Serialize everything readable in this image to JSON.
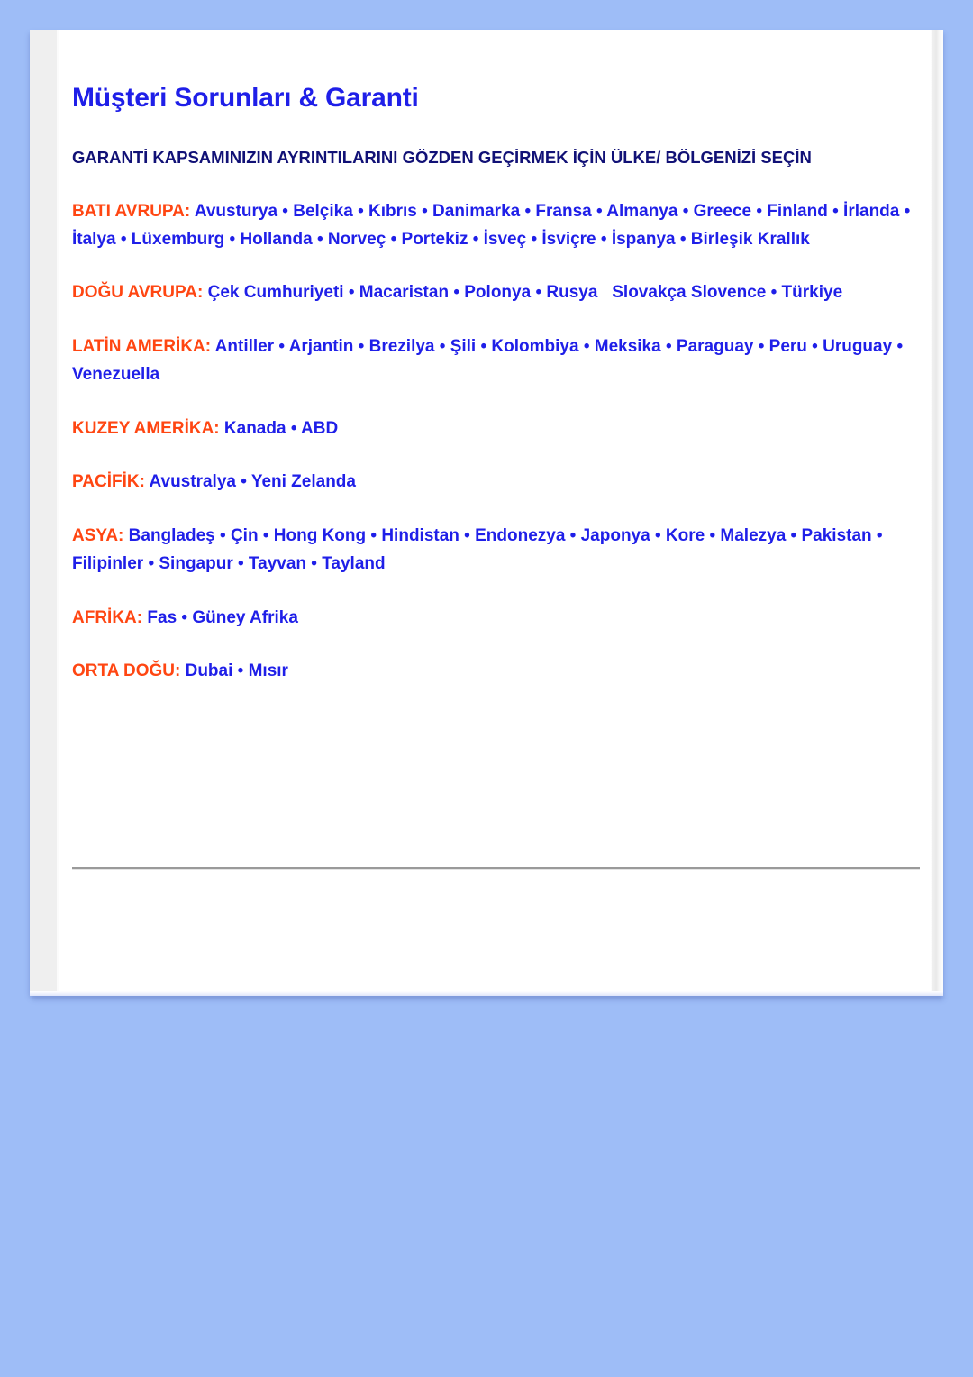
{
  "page": {
    "title": "Müşteri Sorunları & Garanti",
    "instruction": "GARANTİ KAPSAMINIZIN AYRINTILARINI GÖZDEN GEÇİRMEK İÇİN ÜLKE/ BÖLGENİZİ SEÇİN"
  },
  "colors": {
    "background": "#9ebdf7",
    "panel": "#ffffff",
    "gutter": "#efefef",
    "title": "#1f1fe8",
    "instruction": "#111176",
    "region_label": "#ff4612",
    "region_countries": "#1f1fe8",
    "divider": "#9a9a9a"
  },
  "regions": [
    {
      "label": "BATI AVRUPA:",
      "countries": "Avusturya • Belçika • Kıbrıs • Danimarka • Fransa • Almanya • Greece • Finland • İrlanda • İtalya • Lüxemburg • Hollanda • Norveç • Portekiz • İsveç • İsviçre • İspanya • Birleşik Krallık",
      "items": [
        "Avusturya",
        "Belçika",
        "Kıbrıs",
        "Danimarka",
        "Fransa",
        "Almanya",
        "Greece",
        "Finland",
        "İrlanda",
        "İtalya",
        "Lüxemburg",
        "Hollanda",
        "Norveç",
        "Portekiz",
        "İsveç",
        "İsviçre",
        "İspanya",
        "Birleşik Krallık"
      ]
    },
    {
      "label": "DOĞU AVRUPA:",
      "countries": "Çek Cumhuriyeti • Macaristan • Polonya • Rusya   Slovakça Slovence • Türkiye",
      "items": [
        "Çek Cumhuriyeti",
        "Macaristan",
        "Polonya",
        "Rusya",
        "Slovakça",
        "Slovence",
        "Türkiye"
      ]
    },
    {
      "label": "LATİN AMERİKA:",
      "countries": "Antiller • Arjantin • Brezilya • Şili • Kolombiya • Meksika • Paraguay • Peru • Uruguay • Venezuella",
      "items": [
        "Antiller",
        "Arjantin",
        "Brezilya",
        "Şili",
        "Kolombiya",
        "Meksika",
        "Paraguay",
        "Peru",
        "Uruguay",
        "Venezuella"
      ]
    },
    {
      "label": "KUZEY AMERİKA:",
      "countries": "Kanada • ABD",
      "items": [
        "Kanada",
        "ABD"
      ]
    },
    {
      "label": "PACİFİK:",
      "countries": "Avustralya • Yeni Zelanda",
      "items": [
        "Avustralya",
        "Yeni Zelanda"
      ]
    },
    {
      "label": "ASYA:",
      "countries": "Bangladeş • Çin • Hong Kong • Hindistan • Endonezya • Japonya • Kore • Malezya • Pakistan • Filipinler • Singapur • Tayvan • Tayland",
      "items": [
        "Bangladeş",
        "Çin",
        "Hong Kong",
        "Hindistan",
        "Endonezya",
        "Japonya",
        "Kore",
        "Malezya",
        "Pakistan",
        "Filipinler",
        "Singapur",
        "Tayvan",
        "Tayland"
      ]
    },
    {
      "label": "AFRİKA:",
      "countries": "Fas • Güney Afrika",
      "items": [
        "Fas",
        "Güney Afrika"
      ]
    },
    {
      "label": "ORTA DOĞU:",
      "countries": "Dubai • Mısır",
      "items": [
        "Dubai",
        "Mısır"
      ]
    }
  ]
}
